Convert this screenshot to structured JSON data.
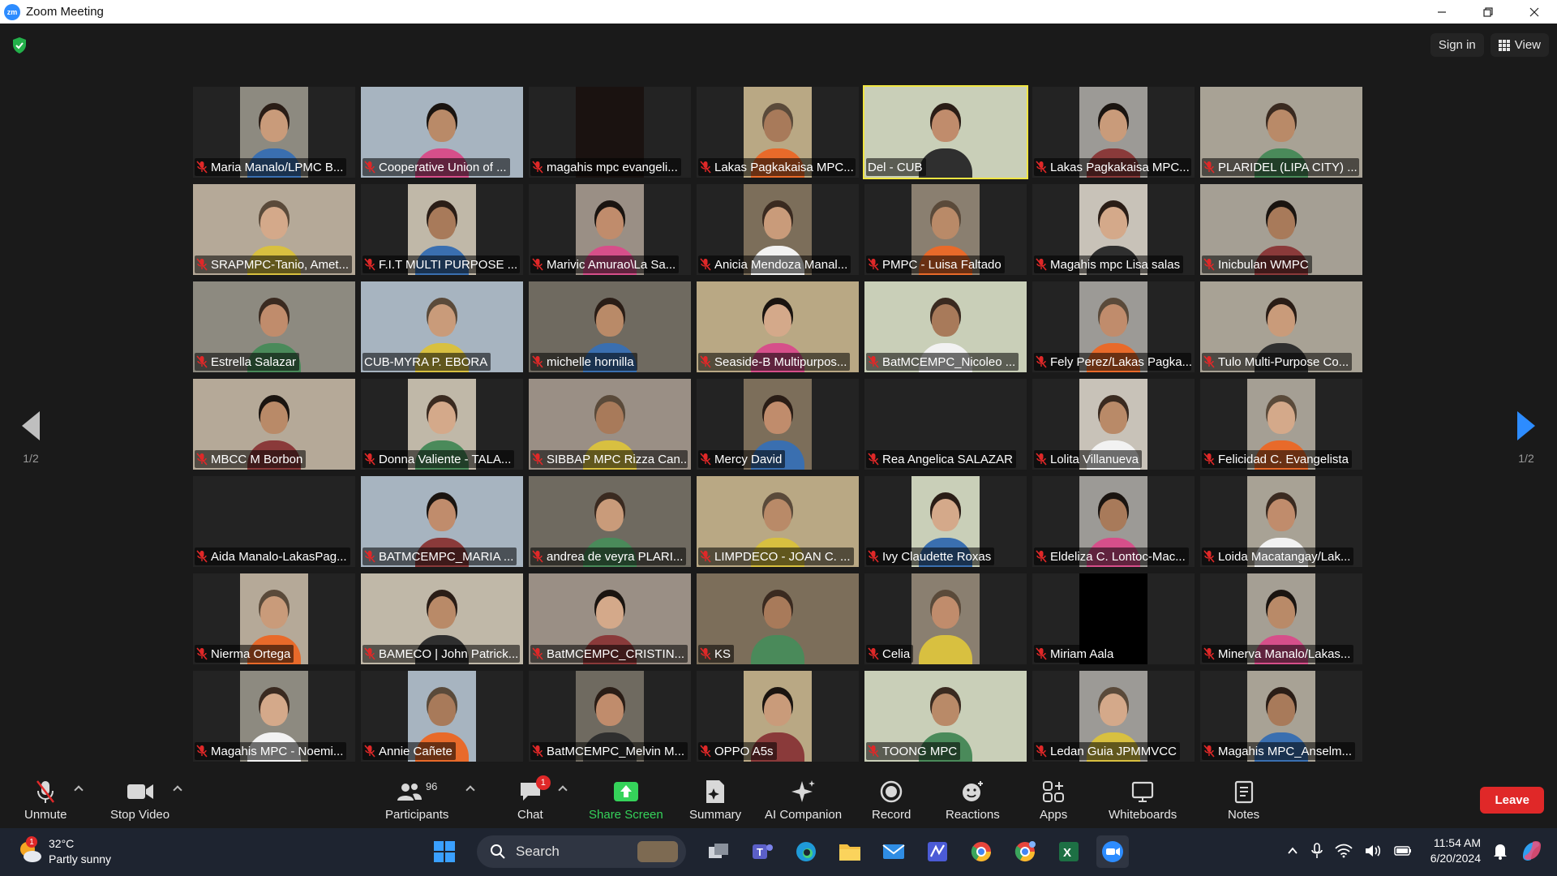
{
  "window": {
    "app_icon": "zm",
    "title": "Zoom Meeting"
  },
  "header": {
    "sign_in": "Sign in",
    "view": "View"
  },
  "pagination": {
    "left": "1/2",
    "right": "1/2"
  },
  "participants": [
    {
      "name": "Maria Manalo/LPMC B...",
      "muted": true
    },
    {
      "name": "Cooperative Union of ...",
      "muted": true
    },
    {
      "name": "magahis mpc evangeli...",
      "muted": true
    },
    {
      "name": "Lakas Pagkakaisa MPC...",
      "muted": true
    },
    {
      "name": "Del - CUB",
      "muted": false,
      "active_speaker": true
    },
    {
      "name": "Lakas Pagkakaisa MPC...",
      "muted": true
    },
    {
      "name": "PLARIDEL (LIPA CITY) ...",
      "muted": true
    },
    {
      "name": "SRAPMPC-Tanio, Amet...",
      "muted": true
    },
    {
      "name": "F.I.T MULTI PURPOSE ...",
      "muted": true
    },
    {
      "name": "Marivic Amurao\\La Sa...",
      "muted": true
    },
    {
      "name": "Anicia Mendoza Manal...",
      "muted": true
    },
    {
      "name": "PMPC - Luisa Faltado",
      "muted": true
    },
    {
      "name": "Magahis mpc Lisa salas",
      "muted": true
    },
    {
      "name": "Inicbulan WMPC",
      "muted": true
    },
    {
      "name": "Estrella Salazar",
      "muted": true
    },
    {
      "name": "CUB-MYRA P. EBORA",
      "muted": false
    },
    {
      "name": "michelle hornilla",
      "muted": true
    },
    {
      "name": "Seaside-B Multipurpos...",
      "muted": true
    },
    {
      "name": "BatMCEMPC_Nicoleo ...",
      "muted": true
    },
    {
      "name": "Fely Perez/Lakas Pagka...",
      "muted": true
    },
    {
      "name": "Tulo Multi-Purpose Co...",
      "muted": true
    },
    {
      "name": "MBCC M Borbon",
      "muted": true
    },
    {
      "name": "Donna Valiente - TALA...",
      "muted": true
    },
    {
      "name": "SIBBAP MPC Rizza Can...",
      "muted": true
    },
    {
      "name": "Mercy David",
      "muted": true
    },
    {
      "name": "Rea Angelica SALAZAR",
      "muted": true
    },
    {
      "name": "Lolita Villanueva",
      "muted": true
    },
    {
      "name": "Felicidad C. Evangelista",
      "muted": true
    },
    {
      "name": "Aida Manalo-LakasPag...",
      "muted": true
    },
    {
      "name": "BATMCEMPC_MARIA ...",
      "muted": true
    },
    {
      "name": "andrea de veyra PLARI...",
      "muted": true
    },
    {
      "name": "LIMPDECO - JOAN C. ...",
      "muted": true
    },
    {
      "name": "Ivy Claudette Roxas",
      "muted": true
    },
    {
      "name": "Eldeliza C. Lontoc-Mac...",
      "muted": true
    },
    {
      "name": "Loida Macatangay/Lak...",
      "muted": true
    },
    {
      "name": "Nierma Ortega",
      "muted": true
    },
    {
      "name": "BAMECO | John Patrick...",
      "muted": true
    },
    {
      "name": "BatMCEMPC_CRISTIN...",
      "muted": true
    },
    {
      "name": "KS",
      "muted": true
    },
    {
      "name": "Celia",
      "muted": true
    },
    {
      "name": "Miriam Aala",
      "muted": true
    },
    {
      "name": "Minerva Manalo/Lakas...",
      "muted": true
    },
    {
      "name": "Magahis MPC - Noemi...",
      "muted": true
    },
    {
      "name": "Annie Cañete",
      "muted": true
    },
    {
      "name": "BatMCEMPC_Melvin M...",
      "muted": true
    },
    {
      "name": "OPPO A5s",
      "muted": true
    },
    {
      "name": "TOONG MPC",
      "muted": true
    },
    {
      "name": "Ledan Guia JPMMVCC",
      "muted": true
    },
    {
      "name": "Magahis MPC_Anselm...",
      "muted": true
    }
  ],
  "toolbar": {
    "unmute": "Unmute",
    "stop_video": "Stop Video",
    "participants": "Participants",
    "participants_count": "96",
    "chat": "Chat",
    "chat_badge": "1",
    "share_screen": "Share Screen",
    "summary": "Summary",
    "ai_companion": "AI Companion",
    "record": "Record",
    "reactions": "Reactions",
    "apps": "Apps",
    "whiteboards": "Whiteboards",
    "notes": "Notes",
    "leave": "Leave"
  },
  "taskbar": {
    "weather_temp": "32°C",
    "weather_desc": "Partly sunny",
    "weather_badge": "1",
    "search": "Search",
    "time": "11:54 AM",
    "date": "6/20/2024"
  },
  "colors": {
    "accent": "#2d8cff",
    "active_speaker": "#f0e542",
    "muted": "#e02828",
    "share_green": "#35d35a",
    "leave": "#e02828"
  }
}
